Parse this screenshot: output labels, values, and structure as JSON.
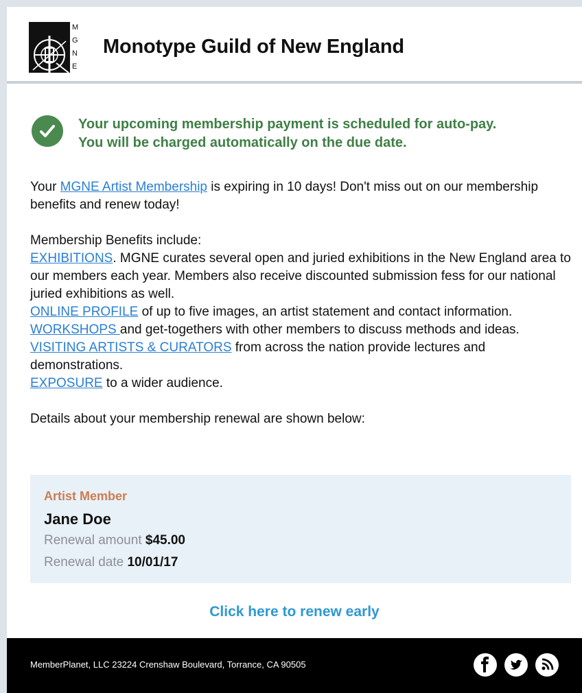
{
  "header": {
    "logo_letters": [
      "M",
      "G",
      "N",
      "E"
    ],
    "org_name": "Monotype Guild of New England"
  },
  "alert": {
    "icon": "check-circle-icon",
    "line1": "Your upcoming membership payment is scheduled for auto-pay.",
    "line2": "You will be charged automatically on the due date.",
    "color": "#3f7f45"
  },
  "intro": {
    "prefix": "Your ",
    "link": "MGNE Artist Membership",
    "suffix": " is expiring in 10 days! Don't miss out on our membership benefits and renew today!"
  },
  "benefits": {
    "heading": "Membership Benefits include:",
    "items": [
      {
        "link": "EXHIBITIONS",
        "text": ". MGNE curates several open and juried exhibitions in the New England area to our members each year. Members also receive discounted submission fess for our national juried exhibitions as well."
      },
      {
        "link": "ONLINE PROFILE",
        "text": " of up to five images, an artist statement and contact information."
      },
      {
        "link": "WORKSHOPS ",
        "text": "and get-togethers with other members to discuss methods and ideas."
      },
      {
        "link": "VISITING ARTISTS & CURATORS",
        "text": " from across the nation provide lectures and demonstrations."
      },
      {
        "link": "EXPOSURE",
        "text": " to a wider audience."
      }
    ]
  },
  "details_text": "Details about your membership renewal are shown below:",
  "renewal": {
    "type": "Artist Member",
    "name": "Jane Doe",
    "amount_label": "Renewal amount ",
    "amount": "$45.00",
    "date_label": "Renewal date ",
    "date": "10/01/17"
  },
  "cta": "Click here to renew early",
  "footer": {
    "text": "MemberPlanet, LLC 23224 Crenshaw Boulevard, Torrance, CA 90505",
    "social": [
      "facebook-icon",
      "twitter-icon",
      "rss-icon"
    ]
  }
}
